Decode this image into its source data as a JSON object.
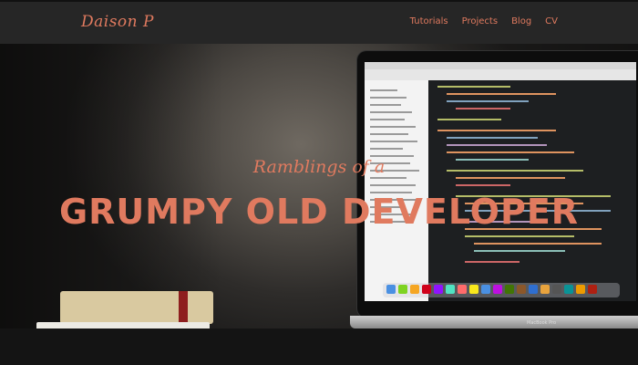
{
  "header": {
    "brand": "Daison P",
    "nav": [
      {
        "label": "Tutorials"
      },
      {
        "label": "Projects"
      },
      {
        "label": "Blog"
      },
      {
        "label": "CV"
      }
    ]
  },
  "hero": {
    "subtitle": "Ramblings of a",
    "title": "GRUMPY OLD DEVELOPER",
    "laptop_label": "MacBook Pro"
  },
  "colors": {
    "accent": "#e07a5f",
    "navbar_bg": "#262626"
  }
}
